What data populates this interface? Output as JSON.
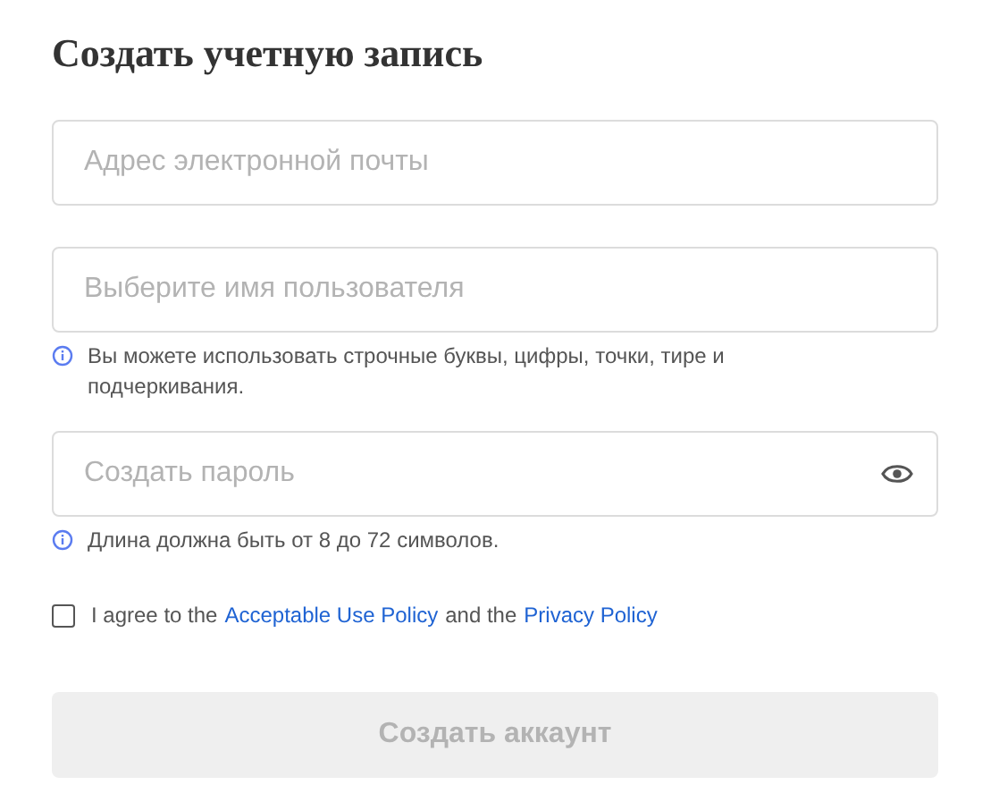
{
  "title": "Создать учетную запись",
  "fields": [
    {
      "kind": "text",
      "placeholder": "Адрес электронной почты"
    },
    {
      "kind": "text",
      "placeholder": "Выберите имя пользователя",
      "hint": "Вы можете использовать строчные буквы, цифры, точки, тире и подчеркивания."
    },
    {
      "kind": "password",
      "placeholder": "Создать пароль",
      "hint": "Длина должна быть от 8 до 72 символов."
    }
  ],
  "agreement": {
    "checked": false,
    "parts": [
      {
        "kind": "text",
        "text": "I agree to the"
      },
      {
        "kind": "link",
        "text": "Acceptable Use Policy"
      },
      {
        "kind": "text",
        "text": "and the"
      },
      {
        "kind": "link",
        "text": "Privacy Policy"
      }
    ]
  },
  "submit": {
    "label": "Создать аккаунт",
    "disabled": true
  }
}
